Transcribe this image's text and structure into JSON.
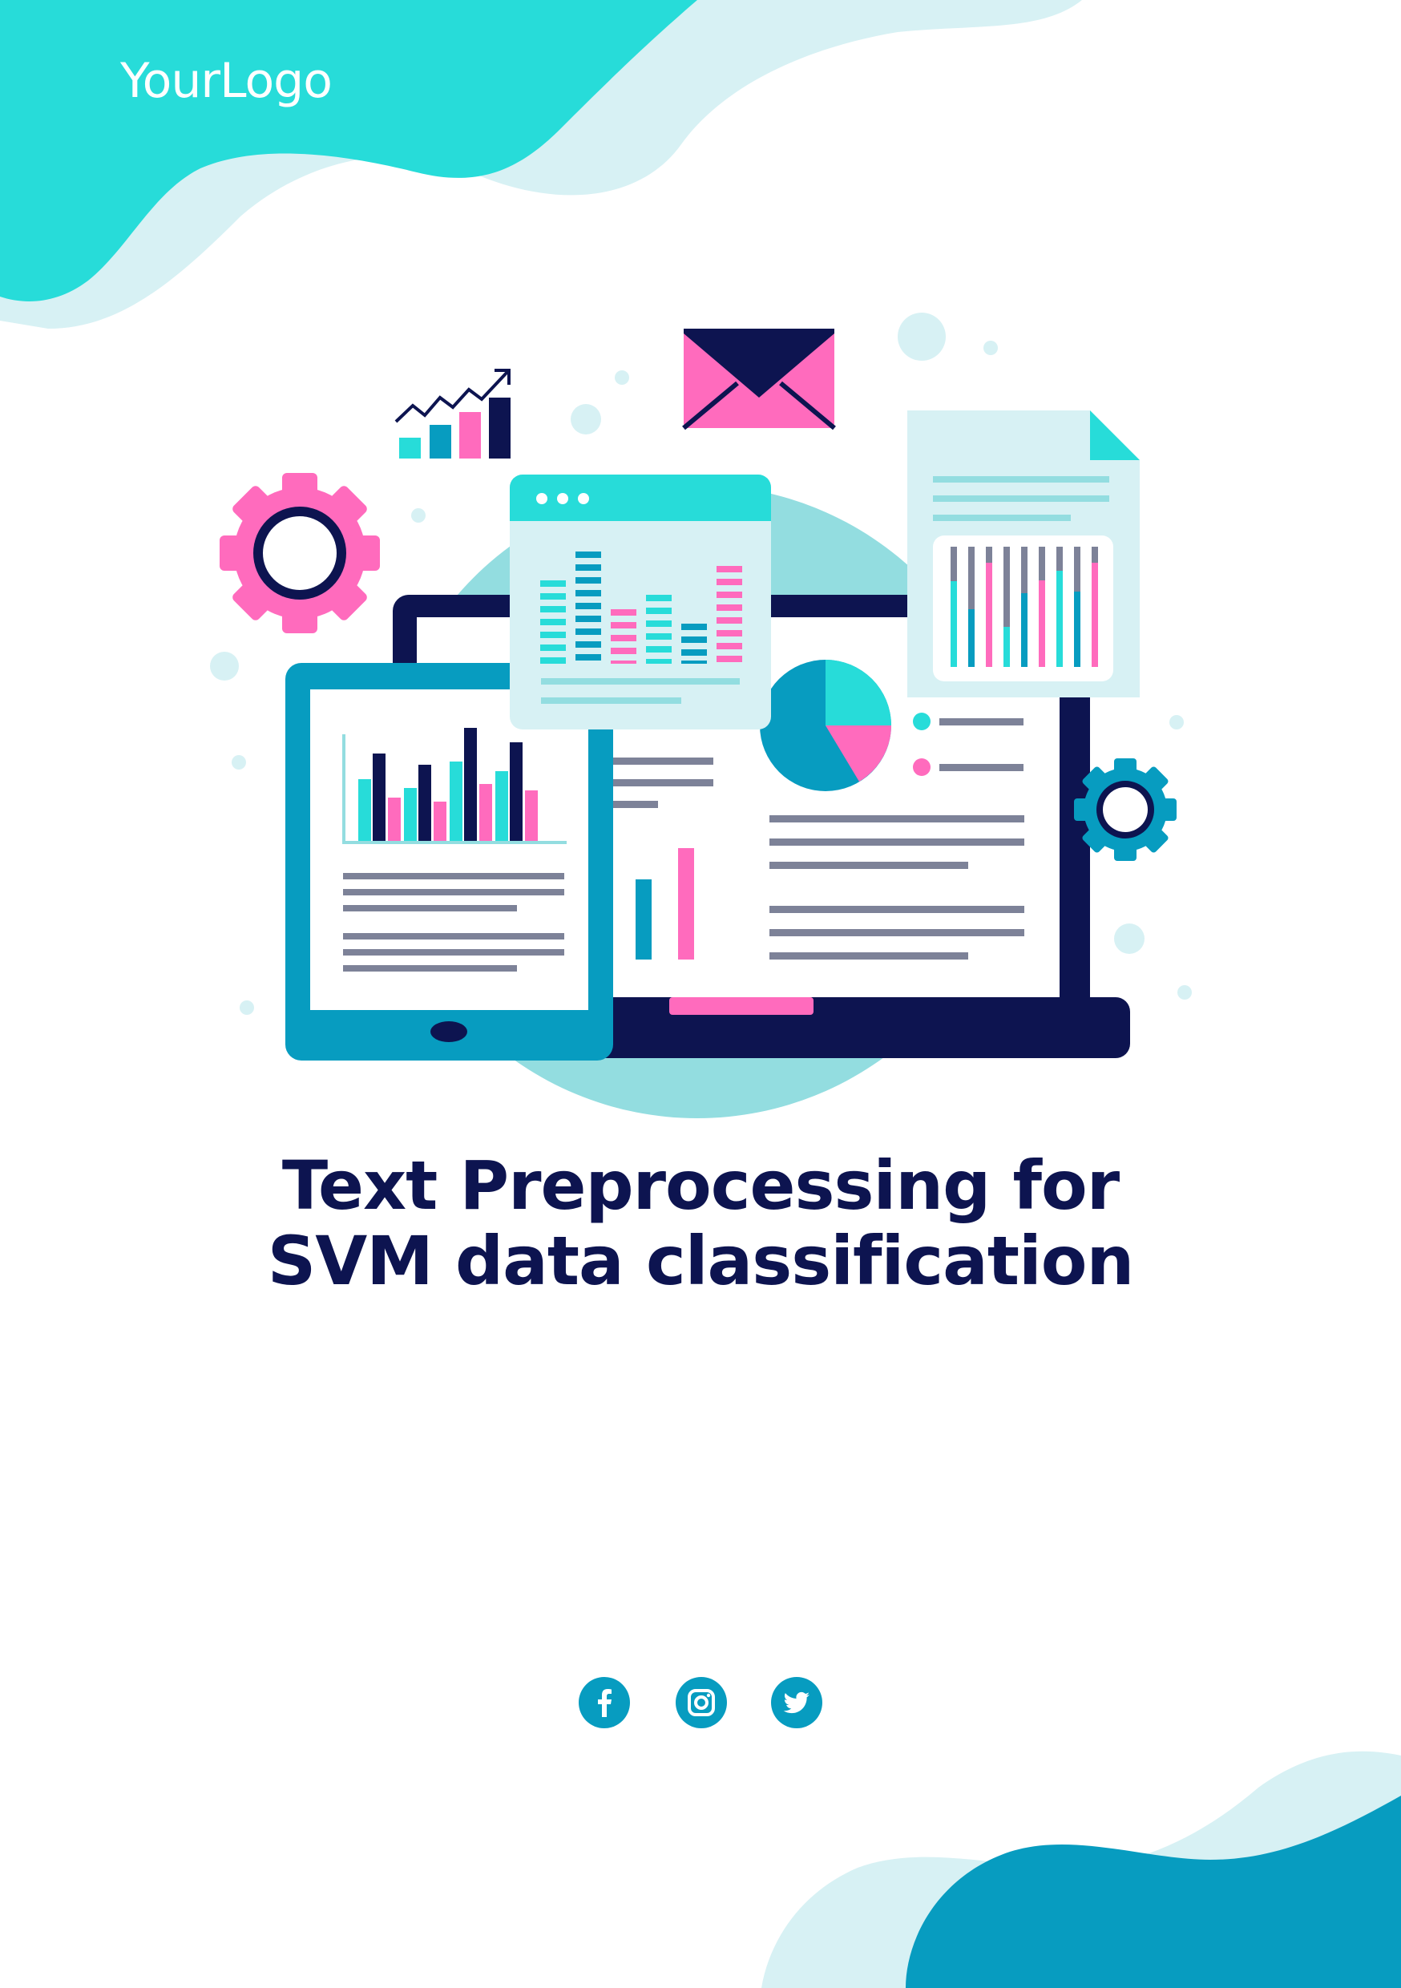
{
  "brand": {
    "logo_text": "YourLogo"
  },
  "title": {
    "line1": "Text Preprocessing for",
    "line2": "SVM data classification"
  },
  "socials": [
    {
      "name": "facebook",
      "icon": "facebook-icon"
    },
    {
      "name": "instagram",
      "icon": "instagram-icon"
    },
    {
      "name": "twitter",
      "icon": "twitter-icon"
    }
  ],
  "colors": {
    "turquoise": "#27dcd9",
    "pale_aqua": "#d7f1f4",
    "navy": "#0d1450",
    "teal_blue": "#079cc0",
    "pink": "#ff6bbd",
    "gray_line": "#7d8298",
    "white": "#ffffff"
  }
}
